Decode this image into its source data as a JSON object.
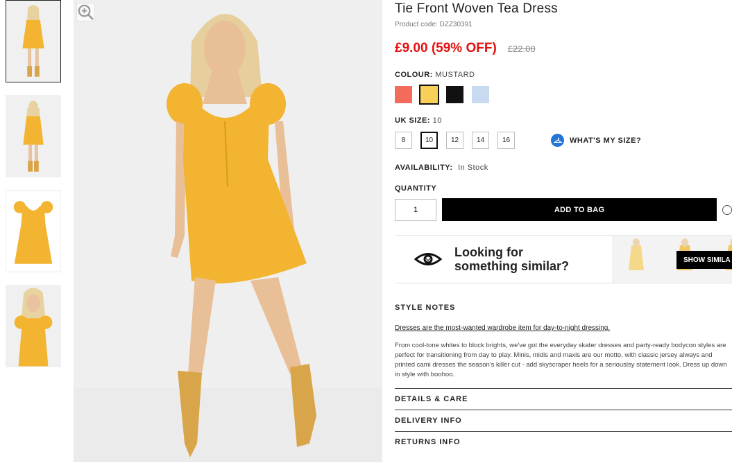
{
  "product": {
    "title": "Tie Front Woven Tea Dress",
    "code": "Product code: DZZ30391",
    "price": "£9.00 (59% OFF)",
    "old_price": "£22.00"
  },
  "colour": {
    "label": "COLOUR:",
    "selected": "MUSTARD",
    "swatches": [
      "#f26b5b",
      "#f8cf58",
      "#111111",
      "#c7daf0"
    ]
  },
  "size": {
    "label": "UK SIZE:",
    "selected": "10",
    "options": [
      "8",
      "10",
      "12",
      "14",
      "16"
    ],
    "guide_label": "WHAT'S MY SIZE?"
  },
  "availability": {
    "label": "AVAILABILITY:",
    "value": "In Stock"
  },
  "quantity": {
    "label": "QUANTITY",
    "value": "1"
  },
  "cart": {
    "add_label": "ADD TO BAG"
  },
  "similar": {
    "line1": "Looking for",
    "line2": "something similar?",
    "button": "SHOW SIMILA"
  },
  "style_notes": {
    "heading": "STYLE NOTES",
    "lead": "Dresses are the most-wanted wardrobe item for day-to-night dressing.",
    "body": "From cool-tone whites to block brights, we've got the everyday skater dresses and party-ready bodycon styles are perfect for transitioning from day to play. Minis, midis and maxis are our motto, with classic jersey always and printed cami dresses the season's killer cut - add skyscraper heels for a seriouslsy statement look. Dress up down in style with boohoo."
  },
  "sections": {
    "details": "DETAILS & CARE",
    "delivery": "DELIVERY INFO",
    "returns": "RETURNS INFO"
  },
  "colors": {
    "accent_red": "#e40f0f",
    "dress_yellow": "#f2b431",
    "info_blue": "#2277d6"
  }
}
